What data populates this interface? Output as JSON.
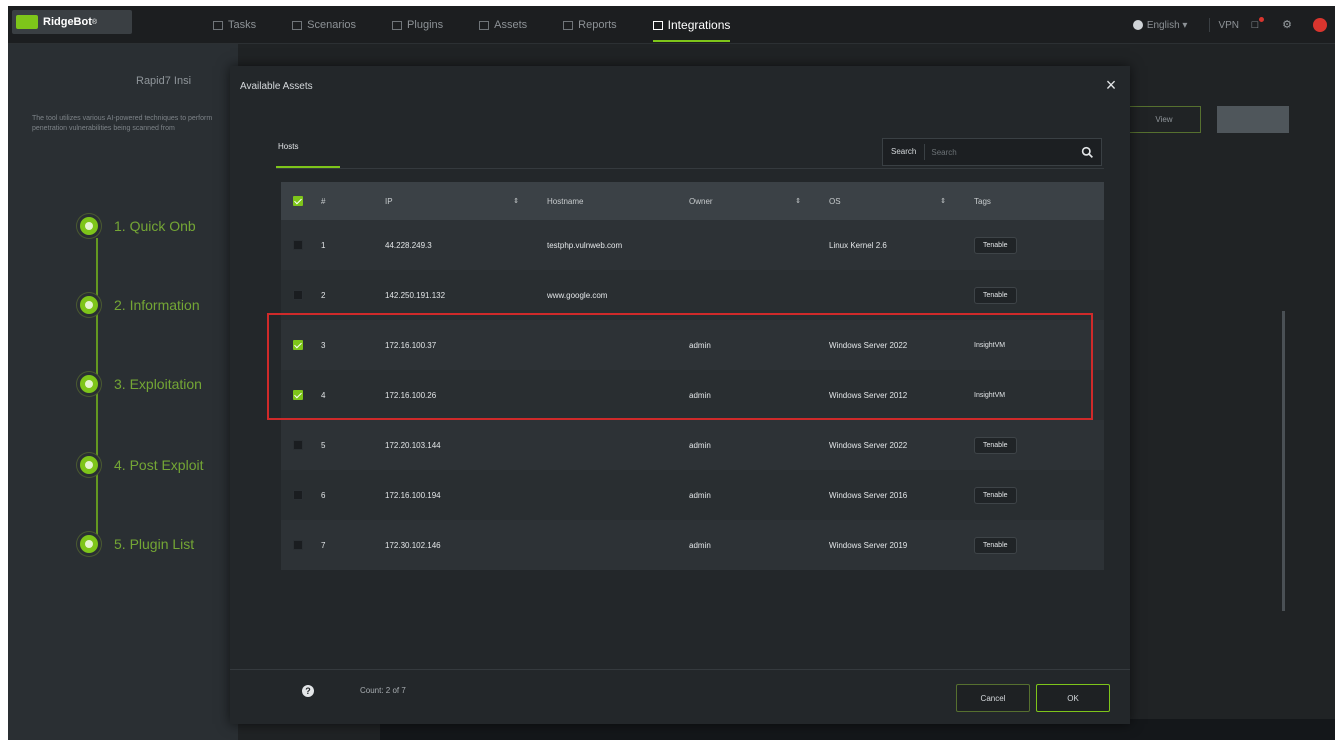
{
  "app": {
    "logo_text": "RidgeBot",
    "logo_sup": "®"
  },
  "nav": [
    {
      "label": "Tasks",
      "icon": "list-icon"
    },
    {
      "label": "Scenarios",
      "icon": "grid-icon"
    },
    {
      "label": "Plugins",
      "icon": "plug-icon"
    },
    {
      "label": "Assets",
      "icon": "box-icon"
    },
    {
      "label": "Reports",
      "icon": "report-icon"
    },
    {
      "label": "Integrations",
      "icon": "integrations-icon",
      "active": true
    }
  ],
  "topright": {
    "language": "English ▾",
    "vpn": "VPN"
  },
  "background": {
    "title": "Rapid7 Insi",
    "description": "The tool utilizes various AI-powered techniques to perform penetration vulnerabilities being scanned from",
    "steps": [
      {
        "label": "1. Quick Onb"
      },
      {
        "label": "2. Information"
      },
      {
        "label": "3. Exploitation"
      },
      {
        "label": "4. Post Exploit"
      },
      {
        "label": "5. Plugin List"
      }
    ],
    "right_button_label": "View"
  },
  "modal": {
    "title": "Available Assets",
    "tab": "Hosts",
    "search_label": "Search",
    "search_placeholder": "Search",
    "columns": {
      "num": "#",
      "ip": "IP",
      "hostname": "Hostname",
      "owner": "Owner",
      "os": "OS",
      "tags": "Tags"
    },
    "rows": [
      {
        "num": "1",
        "ip": "44.228.249.3",
        "hostname": "testphp.vulnweb.com",
        "owner": "",
        "os": "Linux Kernel 2.6",
        "tag": "Tenable",
        "checked": false
      },
      {
        "num": "2",
        "ip": "142.250.191.132",
        "hostname": "www.google.com",
        "owner": "",
        "os": "",
        "tag": "Tenable",
        "checked": false
      },
      {
        "num": "3",
        "ip": "172.16.100.37",
        "hostname": "",
        "owner": "admin",
        "os": "Windows Server 2022",
        "tag": "InsightVM",
        "checked": true
      },
      {
        "num": "4",
        "ip": "172.16.100.26",
        "hostname": "",
        "owner": "admin",
        "os": "Windows Server 2012",
        "tag": "InsightVM",
        "checked": true
      },
      {
        "num": "5",
        "ip": "172.20.103.144",
        "hostname": "",
        "owner": "admin",
        "os": "Windows Server 2022",
        "tag": "Tenable",
        "checked": false
      },
      {
        "num": "6",
        "ip": "172.16.100.194",
        "hostname": "",
        "owner": "admin",
        "os": "Windows Server 2016",
        "tag": "Tenable",
        "checked": false
      },
      {
        "num": "7",
        "ip": "172.30.102.146",
        "hostname": "",
        "owner": "admin",
        "os": "Windows Server 2019",
        "tag": "Tenable",
        "checked": false
      }
    ],
    "count_text": "Count: 2 of 7",
    "cancel_label": "Cancel",
    "ok_label": "OK"
  },
  "colors": {
    "accent": "#7ec51a",
    "highlight": "#cf2a2a",
    "bg": "#202325"
  }
}
